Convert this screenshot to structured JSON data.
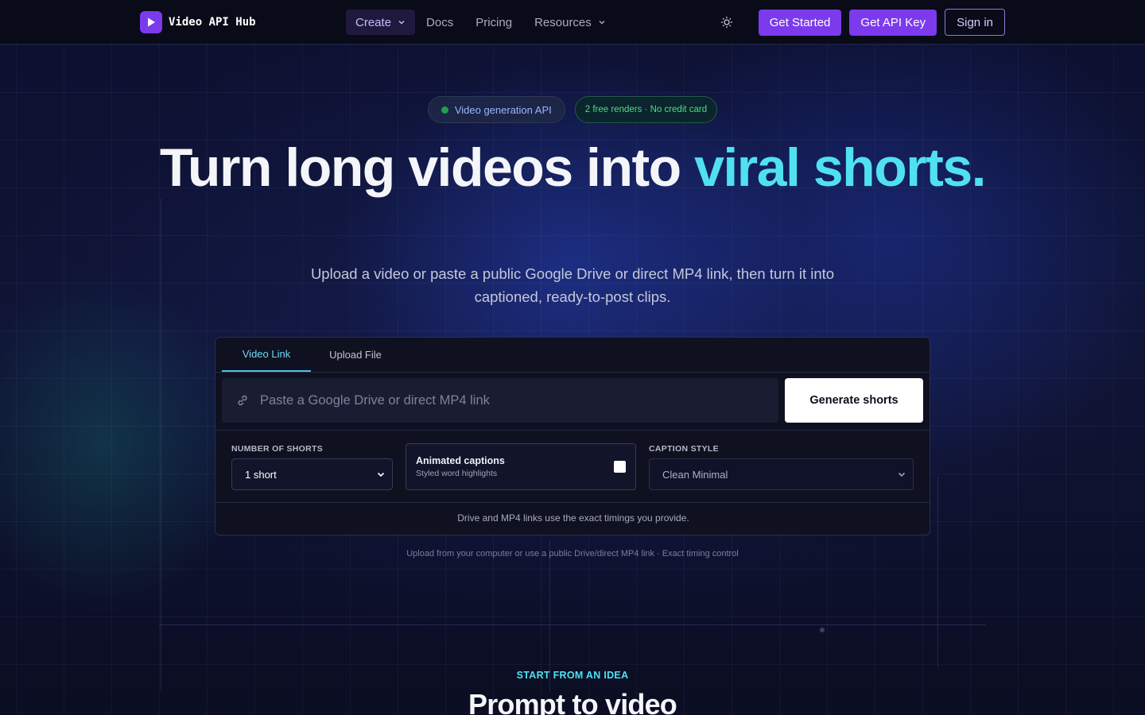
{
  "nav": {
    "logo_text": "Video API Hub",
    "menu": [
      {
        "label": "Create",
        "active": true,
        "dropdown": true
      },
      {
        "label": "Docs"
      },
      {
        "label": "Pricing"
      },
      {
        "label": "Resources",
        "dropdown": true
      }
    ],
    "get_started": "Get Started",
    "get_api_key": "Get API Key",
    "sign_in": "Sign in"
  },
  "hero": {
    "badge_primary": "Video generation API",
    "badge_secondary": "2 free renders · No credit card",
    "headline_plain": "Turn long videos into ",
    "headline_highlight": "viral shorts.",
    "subheadline": "Upload a video or paste a public Google Drive or direct MP4 link, then turn it into captioned, ready-to-post clips."
  },
  "card": {
    "tabs": [
      "Video Link",
      "Upload File"
    ],
    "active_tab": "Video Link",
    "url_placeholder": "Paste a Google Drive or direct MP4 link",
    "url_value": "",
    "generate_button": "Generate shorts",
    "number_of_shorts_label": "NUMBER OF SHORTS",
    "number_of_shorts_value": "1 short",
    "animated_captions_title": "Animated captions",
    "animated_captions_sub": "Styled word highlights",
    "animated_captions_checked": false,
    "caption_style_label": "CAPTION STYLE",
    "caption_style_value": "Clean Minimal",
    "note": "Drive and MP4 links use the exact timings you provide."
  },
  "under_note": "Upload from your computer or use a public Drive/direct MP4 link · Exact timing control",
  "next_section": {
    "kicker": "START FROM AN IDEA",
    "title": "Prompt to video"
  },
  "colors": {
    "accent_purple": "#7c3aed",
    "accent_cyan": "#4fe1f2",
    "badge_green": "#4ade80",
    "background": "#0b0d1f"
  }
}
